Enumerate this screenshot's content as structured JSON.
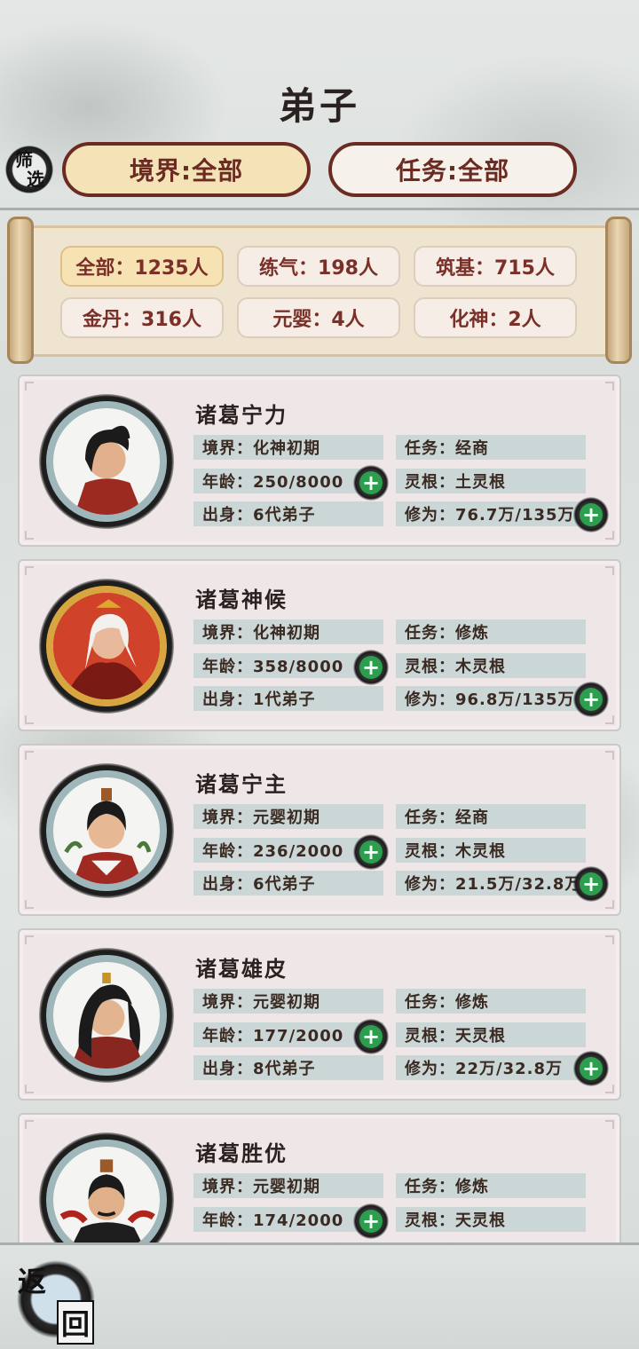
{
  "page": {
    "title": "弟子",
    "filter_badge": [
      "筛",
      "选"
    ],
    "filters": {
      "realm": "境界:全部",
      "task": "任务:全部"
    }
  },
  "stats": [
    {
      "label": "全部：1235人",
      "active": true
    },
    {
      "label": "练气：198人",
      "active": false
    },
    {
      "label": "筑基：715人",
      "active": false
    },
    {
      "label": "金丹：316人",
      "active": false
    },
    {
      "label": "元婴：4人",
      "active": false
    },
    {
      "label": "化神：2人",
      "active": false
    }
  ],
  "disciples": [
    {
      "name": "诸葛宁力",
      "realm": "境界：化神初期",
      "task": "任务：经商",
      "age": "年龄：250/8000",
      "root": "灵根：土灵根",
      "origin": "出身：6代弟子",
      "cultivation": "修为：76.7万/135万"
    },
    {
      "name": "诸葛神候",
      "realm": "境界：化神初期",
      "task": "任务：修炼",
      "age": "年龄：358/8000",
      "root": "灵根：木灵根",
      "origin": "出身：1代弟子",
      "cultivation": "修为：96.8万/135万"
    },
    {
      "name": "诸葛宁主",
      "realm": "境界：元婴初期",
      "task": "任务：经商",
      "age": "年龄：236/2000",
      "root": "灵根：木灵根",
      "origin": "出身：6代弟子",
      "cultivation": "修为：21.5万/32.8万"
    },
    {
      "name": "诸葛雄皮",
      "realm": "境界：元婴初期",
      "task": "任务：修炼",
      "age": "年龄：177/2000",
      "root": "灵根：天灵根",
      "origin": "出身：8代弟子",
      "cultivation": "修为：22万/32.8万"
    },
    {
      "name": "诸葛胜优",
      "realm": "境界：元婴初期",
      "task": "任务：修炼",
      "age": "年龄：174/2000",
      "root": "灵根：天灵根"
    }
  ],
  "plus_symbol": "+",
  "back_button": [
    "返",
    "回"
  ],
  "colors": {
    "accent": "#6b2a22",
    "realm_pill_bg": "#f5e3b8",
    "field_bg": "#cbd6d6",
    "plus_green": "#2c9f4e"
  }
}
